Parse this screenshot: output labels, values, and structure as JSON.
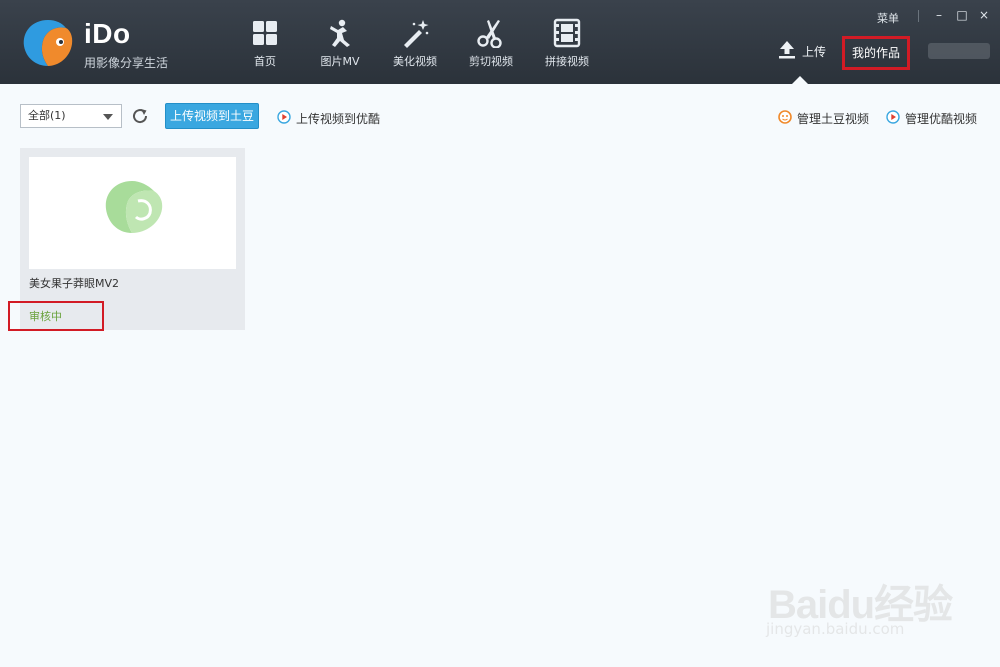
{
  "app": {
    "name": "iDo",
    "slogan": "用影像分享生活"
  },
  "nav": [
    {
      "label": "首页",
      "icon": "home-grid-icon"
    },
    {
      "label": "图片MV",
      "icon": "dancer-icon"
    },
    {
      "label": "美化视频",
      "icon": "magic-wand-icon"
    },
    {
      "label": "剪切视频",
      "icon": "scissors-icon"
    },
    {
      "label": "拼接视频",
      "icon": "film-strip-icon"
    }
  ],
  "window": {
    "menu_label": "菜单",
    "minimize": "–",
    "maximize": "□",
    "close": "×"
  },
  "header": {
    "upload_label": "上传",
    "my_works_label": "我的作品"
  },
  "toolbar": {
    "filter_value": "全部(1)",
    "upload_tudou_label": "上传视频到土豆",
    "upload_youku_label": "上传视频到优酷",
    "manage_tudou_label": "管理土豆视频",
    "manage_youku_label": "管理优酷视频"
  },
  "works": [
    {
      "title": "美女果子莽眼MV2",
      "status": "审核中"
    }
  ],
  "watermark": {
    "brand": "Baidu经验",
    "url": "jingyan.baidu.com"
  },
  "colors": {
    "accent": "#3aa7e0",
    "highlight": "#d21b25",
    "status": "#6aa23d",
    "topbar": "#333a42"
  }
}
